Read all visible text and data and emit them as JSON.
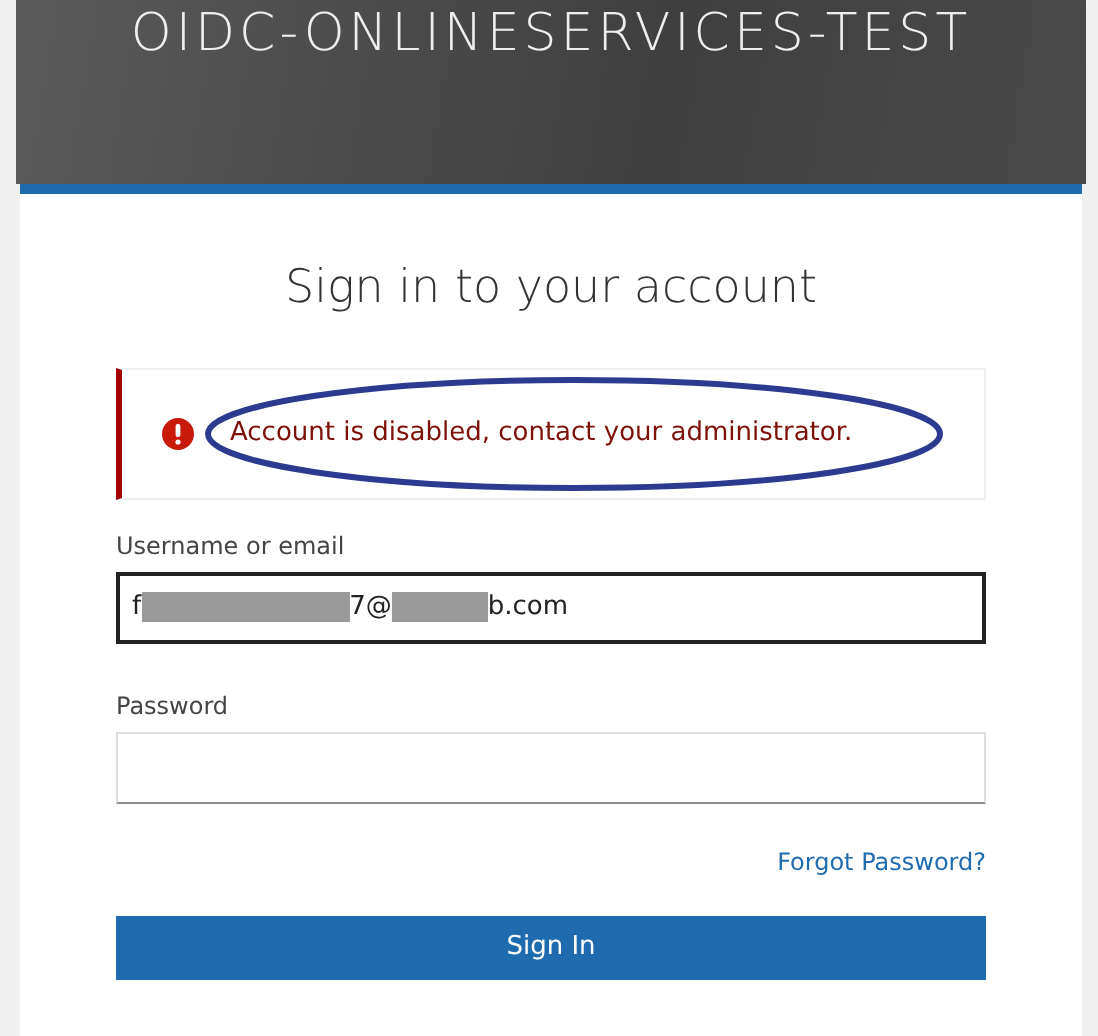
{
  "realm_title": "OIDC-ONLINESERVICES-TEST",
  "heading": "Sign in to your account",
  "alert": {
    "kind": "error",
    "message": "Account is disabled, contact your administrator.",
    "annotated": true
  },
  "username": {
    "label": "Username or email",
    "focused": true,
    "value_segments": [
      {
        "kind": "text",
        "text": "f"
      },
      {
        "kind": "redacted"
      },
      {
        "kind": "text",
        "text": "7@"
      },
      {
        "kind": "redacted"
      },
      {
        "kind": "text",
        "text": "b.com"
      }
    ]
  },
  "password": {
    "label": "Password",
    "focused": false
  },
  "forgot_link": "Forgot Password?",
  "submit": "Sign In"
}
